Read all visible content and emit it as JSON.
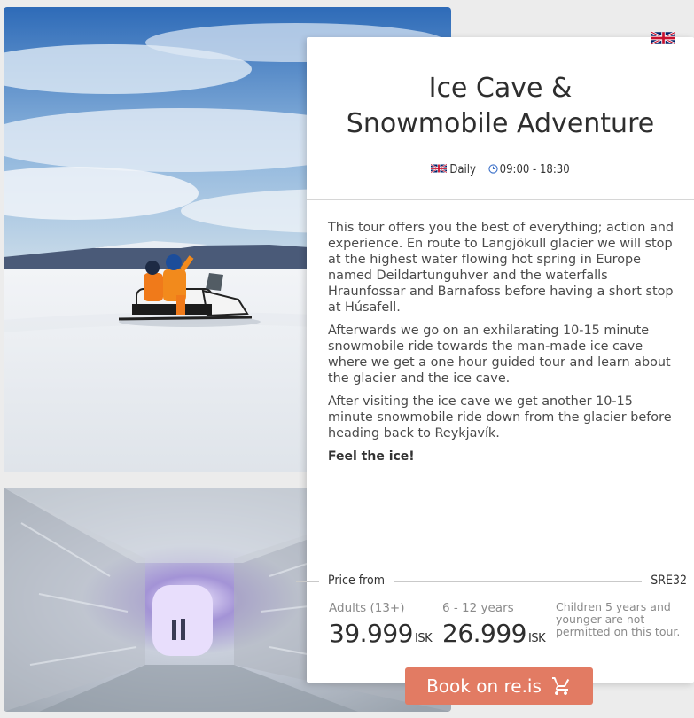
{
  "tour": {
    "title_line1": "Ice Cave &",
    "title_line2": "Snowmobile Adventure",
    "schedule": "Daily",
    "hours": "09:00 - 18:30",
    "language_icon": "uk-flag-icon",
    "description": [
      "This tour offers you the best of everything; action and experience. En route to Langjökull glacier we will stop at the highest water flowing hot spring in Europe named Deildartunguhver and the waterfalls Hraunfossar and Barnafoss before having a short stop at Húsafell.",
      "Afterwards we go on an exhilarating 10-15 minute snowmobile ride towards the man-made ice cave where we get a one hour guided tour and learn about the glacier and the ice cave.",
      "After visiting the ice cave we get another 10-15 minute snowmobile ride down from the glacier before heading back to Reykjavík."
    ],
    "tagline": "Feel the ice!"
  },
  "pricing": {
    "label": "Price from",
    "code": "SRE32",
    "tiers": [
      {
        "label": "Adults (13+)",
        "amount": "39.999",
        "currency": "ISK"
      },
      {
        "label": "6 - 12 years",
        "amount": "26.999",
        "currency": "ISK"
      }
    ],
    "note": "Children 5 years and younger are not permitted on this tour."
  },
  "cta": {
    "label": "Book on re.is",
    "icon": "cart-icon"
  },
  "colors": {
    "accent": "#e27b63",
    "text": "#3a3a3a",
    "muted": "#8a8a8a"
  }
}
